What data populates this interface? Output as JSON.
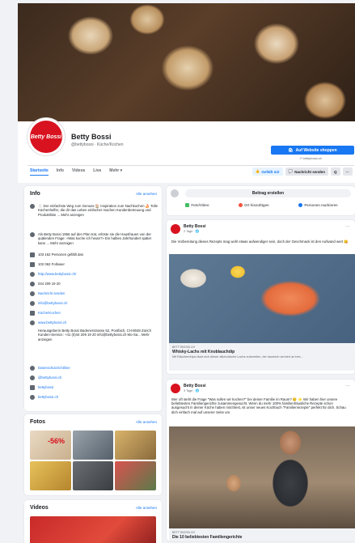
{
  "page": {
    "name": "Betty Bossi",
    "subtitle": "@bettybossi · Küche/Kochen",
    "avatar_text": "Betty Bossi",
    "shop_button": "Auf Website shoppen",
    "shop_url": "bettybossi.ch"
  },
  "tabs": [
    "Startseite",
    "Info",
    "Videos",
    "Live",
    "Mehr ▾"
  ],
  "actions": {
    "like": "Gefällt mir",
    "message": "Nachricht senden",
    "search": "Q",
    "more": "···"
  },
  "info": {
    "title": "Info",
    "see_all": "Alle ansehen",
    "rows": [
      {
        "icon": "info-icon",
        "text": "🍴 Der einfachste Weg zum Genuss 🏠 Inspiration zum Nachkochen 🍰 Tolle Küchenhelfer, die dir das Leben einfacher machen Kundenbetreuung und Produktlinie ... Mehr anzeigen"
      },
      {
        "icon": "info-icon",
        "text": "Als Betty Bossi 1956 auf den Plan trat, erlöste sie die Hausfrauen von der quälenden Frage: «Was koche ich heute?» Ein halbes Jahrhundert später kann ... Mehr anzeigen"
      },
      {
        "icon": "like-icon",
        "text": "103 162 Personen gefällt das"
      },
      {
        "icon": "follower-icon",
        "text": "102 062 Follower"
      },
      {
        "icon": "web-icon",
        "text": "http://www.bettybossi.ch/"
      },
      {
        "icon": "phone-icon",
        "text": "044 209 19 20"
      },
      {
        "icon": "messenger-icon",
        "text": "Nachricht senden"
      },
      {
        "icon": "mail-icon",
        "text": "info@bettybossi.ch"
      },
      {
        "icon": "category-icon",
        "text": "Küche/Kochen"
      },
      {
        "icon": "web-icon",
        "text": "www.bettybossi.ch"
      },
      {
        "icon": "",
        "text": "Herausgeberin Betty Bossi Badenerstrasse 52, Postfach, CH-8048 Zürich Kunden-Service: +41 (0)44 209 19 20 info@bettybossi.ch Mo-Sa... Mehr anzeigen"
      },
      {
        "icon": "privacy-icon",
        "text": "Datenschutzrichtlinie"
      },
      {
        "icon": "instagram-icon",
        "text": "@bettybossi.ch"
      },
      {
        "icon": "web-icon",
        "text": "bettybossi"
      },
      {
        "icon": "pinterest-icon",
        "text": "bettybossi.ch"
      }
    ]
  },
  "fotos": {
    "title": "Fotos",
    "see_all": "Alle ansehen",
    "sale_badge": "-56%"
  },
  "videos": {
    "title": "Videos",
    "see_all": "Alle ansehen"
  },
  "composer": {
    "button": "Beitrag erstellen",
    "options": [
      "Foto/Video",
      "Ort hinzufügen",
      "Personen markieren"
    ]
  },
  "posts": [
    {
      "author": "Betty Bossi",
      "time": "2 Tage · 🌐",
      "text": "Die Vorbereitung dieses Rezepts mag wohl etwas aufwendiger sein, doch der Geschmack ist den Aufwand wert 😋",
      "link_source": "BETTYBOSSI.CH",
      "link_title": "Whisky-Lachs mit Knoblauchdip",
      "link_desc": "Mit Räucherchips lässt sich dieser alkoholische Lachs zubereiten, der laumerin serviert an bes..."
    },
    {
      "author": "Betty Bossi",
      "time": "3 Tage · 🌐",
      "text": "Wer oft steht die Frage \"Was sollen wir kochen?\" bei deiner Familie im Raum? 😊 ⭐ Wir haben hier unsere beliebtesten Familiengerichte zusammengesucht. Wenn du mehr 100% familienhäusliche Rezepte schon ausgesucht in deiner Küche haben möchtest, ist unser neues Kochbuch \"Familienrezepte\" perfekt für dich. Schau dich einfach mal auf unserer Seite um.",
      "link_source": "BETTYBOSSI.CH",
      "link_title": "Die 10 beliebtesten Familiengerichte"
    }
  ],
  "colors": {
    "accent": "#1877f2",
    "brand": "#d8121f",
    "bg": "#f0f2f5"
  }
}
